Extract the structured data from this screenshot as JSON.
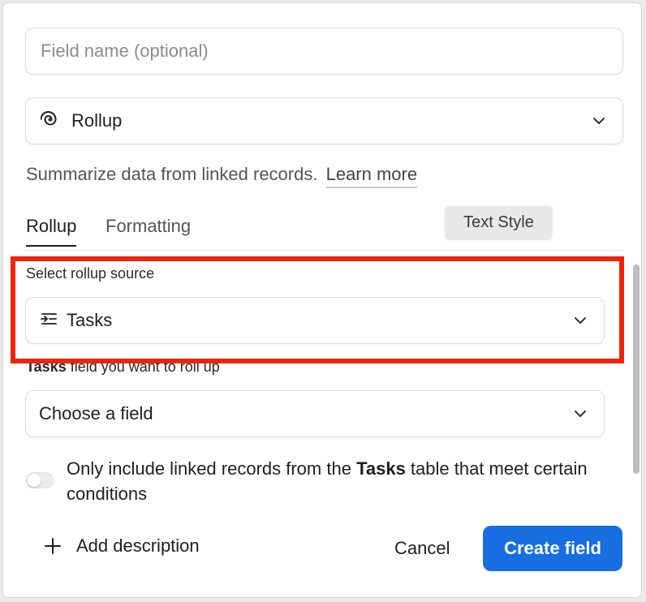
{
  "field_name": {
    "placeholder": "Field name (optional)",
    "value": ""
  },
  "type_select": {
    "icon": "spiral-icon",
    "label": "Rollup"
  },
  "description": {
    "text": "Summarize data from linked records.",
    "learn_more": "Learn more"
  },
  "tabs": [
    {
      "label": "Rollup",
      "active": true
    },
    {
      "label": "Formatting",
      "active": false
    }
  ],
  "tooltip": {
    "text": "Text Style"
  },
  "rollup_source": {
    "label": "Select rollup source",
    "value": "Tasks",
    "icon": "linked-record-icon"
  },
  "field_select": {
    "label_bold": "Tasks",
    "label_rest": " field you want to roll up",
    "value": "Choose a field"
  },
  "condition": {
    "prefix": "Only include linked records from the ",
    "table": "Tasks",
    "suffix": " table that meet certain conditions",
    "enabled": false
  },
  "footer": {
    "add_description": "Add description",
    "cancel": "Cancel",
    "create": "Create field"
  },
  "colors": {
    "primary": "#166ee1",
    "highlight": "#f0230d"
  }
}
